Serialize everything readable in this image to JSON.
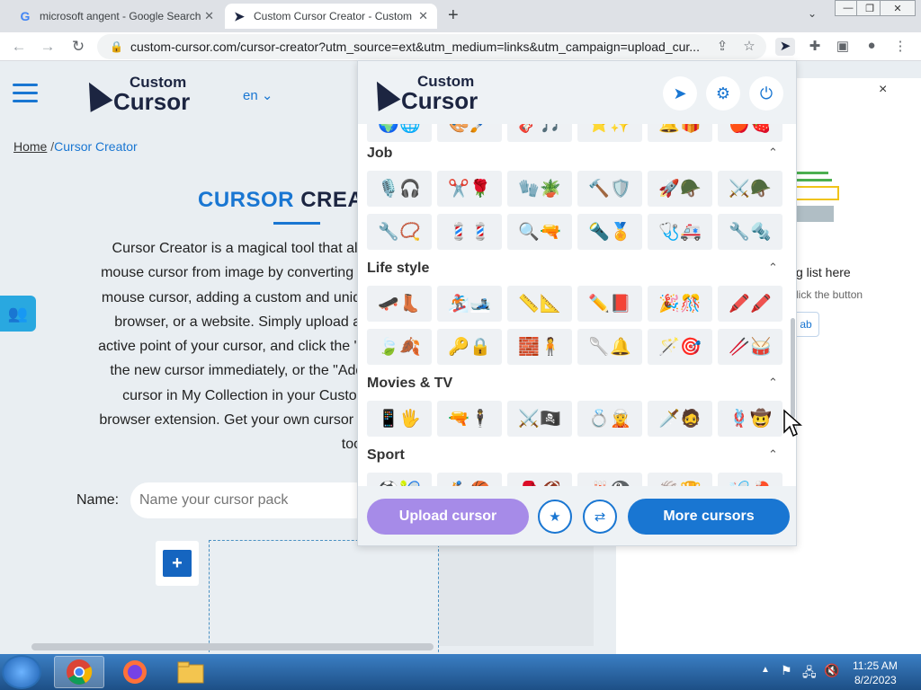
{
  "browser": {
    "tabs": [
      {
        "label": "microsoft angent - Google Search",
        "favicon": "G"
      },
      {
        "label": "Custom Cursor Creator - Custom",
        "favicon": "cursor-logo"
      }
    ],
    "url": "custom-cursor.com/cursor-creator?utm_source=ext&utm_medium=links&utm_campaign=upload_cur..."
  },
  "site": {
    "logo": {
      "line1": "Custom",
      "line2": "Cursor"
    },
    "lang": "en",
    "breadcrumb": {
      "home": "Home",
      "sep": "/",
      "current": "Cursor Creator"
    },
    "title_a": "CURSOR",
    "title_b": "CREAT",
    "description": "Cursor Creator is a magical tool that allo\nmouse cursor from image by converting al\nmouse cursor, adding a custom and uniqu\nbrowser, or a website. Simply upload an\nactive point of your cursor, and click the \"S\nthe new cursor immediately, or the \"Add\"\ncursor in My Collection in your Custom\nbrowser extension. Get your own cursor st\ntool.",
    "name_label": "Name:",
    "name_placeholder": "Name your cursor pack",
    "add_plus": "+"
  },
  "right_panel": {
    "close": "×",
    "text1": "g list here",
    "text2": "lick the button",
    "button": "ab"
  },
  "popup": {
    "logo": {
      "line1": "Custom",
      "line2": "Cursor"
    },
    "categories": [
      {
        "name": "Job",
        "rows": [
          [
            "🎙️🎧",
            "✂️🌹",
            "🧤🪴",
            "🔨🛡️",
            "🚀🪖",
            "⚔️🪖"
          ],
          [
            "🔧📿",
            "💈💈",
            "🔍🔫",
            "🔦🏅",
            "🩺🚑",
            "🔧🔩"
          ]
        ]
      },
      {
        "name": "Life style",
        "rows": [
          [
            "🛹👢",
            "🏂🎿",
            "📏📐",
            "✏️📕",
            "🎉🎊",
            "🖍️🖍️"
          ],
          [
            "🍃🍂",
            "🔑🔒",
            "🧱🧍",
            "🥄🔔",
            "🪄🎯",
            "🥢🥁"
          ]
        ]
      },
      {
        "name": "Movies & TV",
        "rows": [
          [
            "📱🖐️",
            "🔫🕴️",
            "⚔️🏴‍☠️",
            "💍🧝",
            "🗡️🧔",
            "🪢🤠"
          ]
        ]
      },
      {
        "name": "Sport",
        "rows": [
          [
            "⚽🎾",
            "🏌️🏀",
            "🥊🏈",
            "🎳🎱",
            "🏐🏆",
            "🏸🏓"
          ]
        ]
      }
    ],
    "partial_top_row": [
      "🌍🌐",
      "🎨🖌️",
      "🎸🎵",
      "⭐✨",
      "🔔🎁",
      "🍎🍓"
    ],
    "upload_label": "Upload cursor",
    "more_label": "More cursors"
  },
  "taskbar": {
    "time": "11:25 AM",
    "date": "8/2/2023"
  }
}
